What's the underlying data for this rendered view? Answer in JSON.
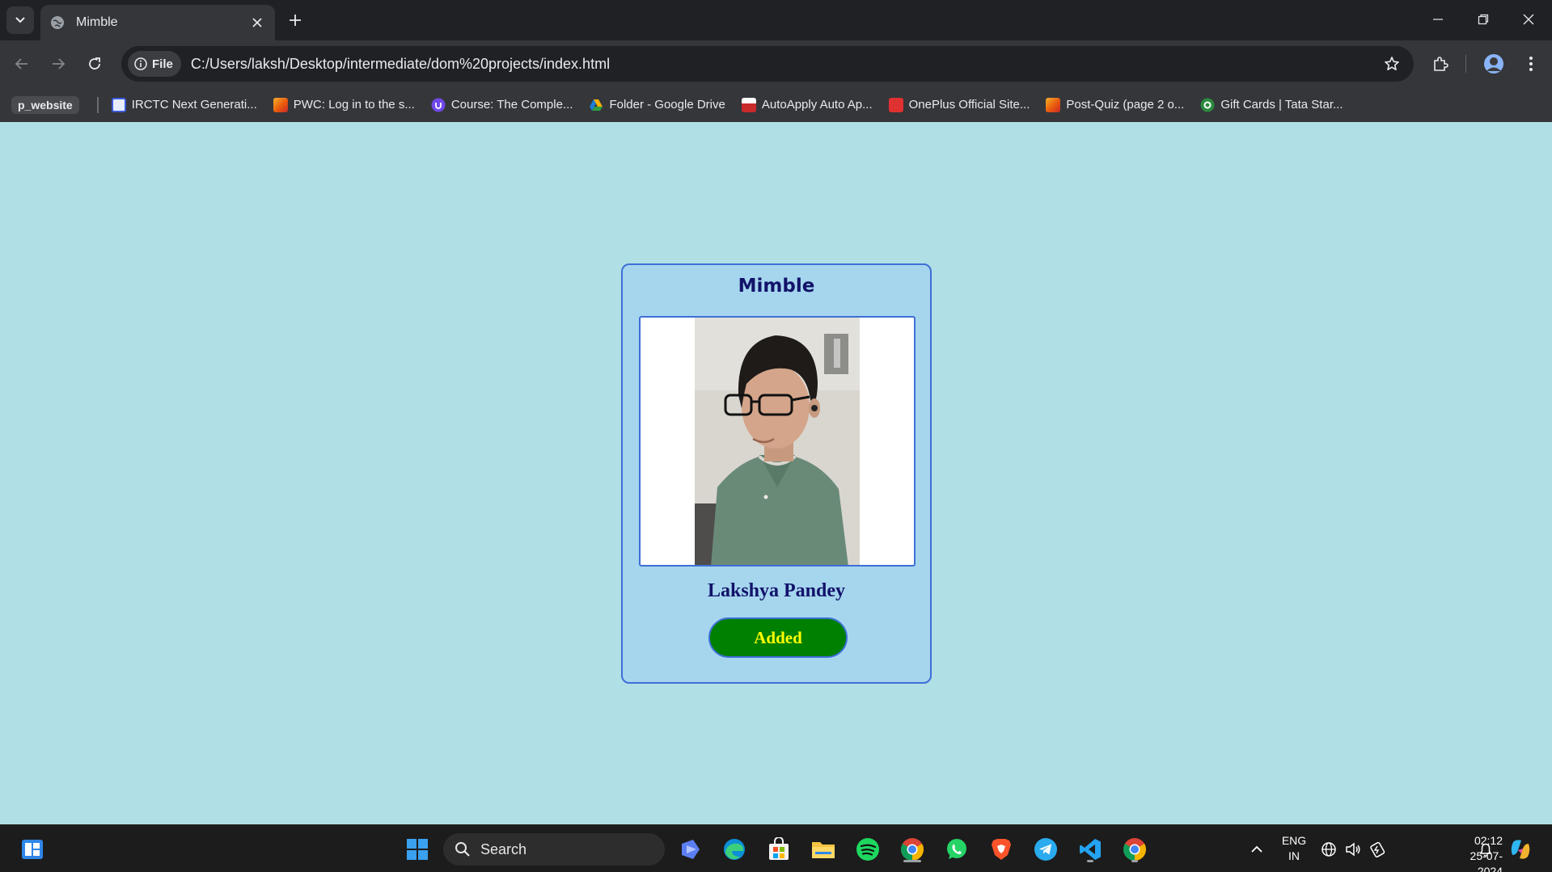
{
  "browser": {
    "tab": {
      "title": "Mimble"
    },
    "omnibox": {
      "chip_label": "File",
      "url": "C:/Users/laksh/Desktop/intermediate/dom%20projects/index.html"
    },
    "bookmarks": [
      {
        "label": "p_website",
        "type": "folder"
      },
      {
        "label": "IRCTC Next Generati...",
        "color": "#3b5bdb"
      },
      {
        "label": "PWC: Log in to the s...",
        "color": "#e8590c"
      },
      {
        "label": "Course: The Comple...",
        "color": "#7048e8"
      },
      {
        "label": "Folder - Google Drive",
        "color": "#fab005"
      },
      {
        "label": "AutoApply Auto Ap...",
        "color": "#c92a2a"
      },
      {
        "label": "OnePlus Official Site...",
        "color": "#e03131"
      },
      {
        "label": "Post-Quiz (page 2 o...",
        "color": "#e8590c"
      },
      {
        "label": "Gift Cards | Tata Star...",
        "color": "#2b8a3e"
      }
    ]
  },
  "card": {
    "title": "Mimble",
    "name": "Lakshya Pandey",
    "button_label": "Added"
  },
  "colors": {
    "page_bg": "#b0dfe5",
    "card_bg": "#a5d6ee",
    "border": "#3f6fd6",
    "title_text": "#12136a",
    "button_bg": "#008000",
    "button_text": "#ffff00"
  },
  "taskbar": {
    "search_placeholder": "Search",
    "language": {
      "line1": "ENG",
      "line2": "IN"
    },
    "time": "02:12",
    "date": "25-07-2024"
  }
}
